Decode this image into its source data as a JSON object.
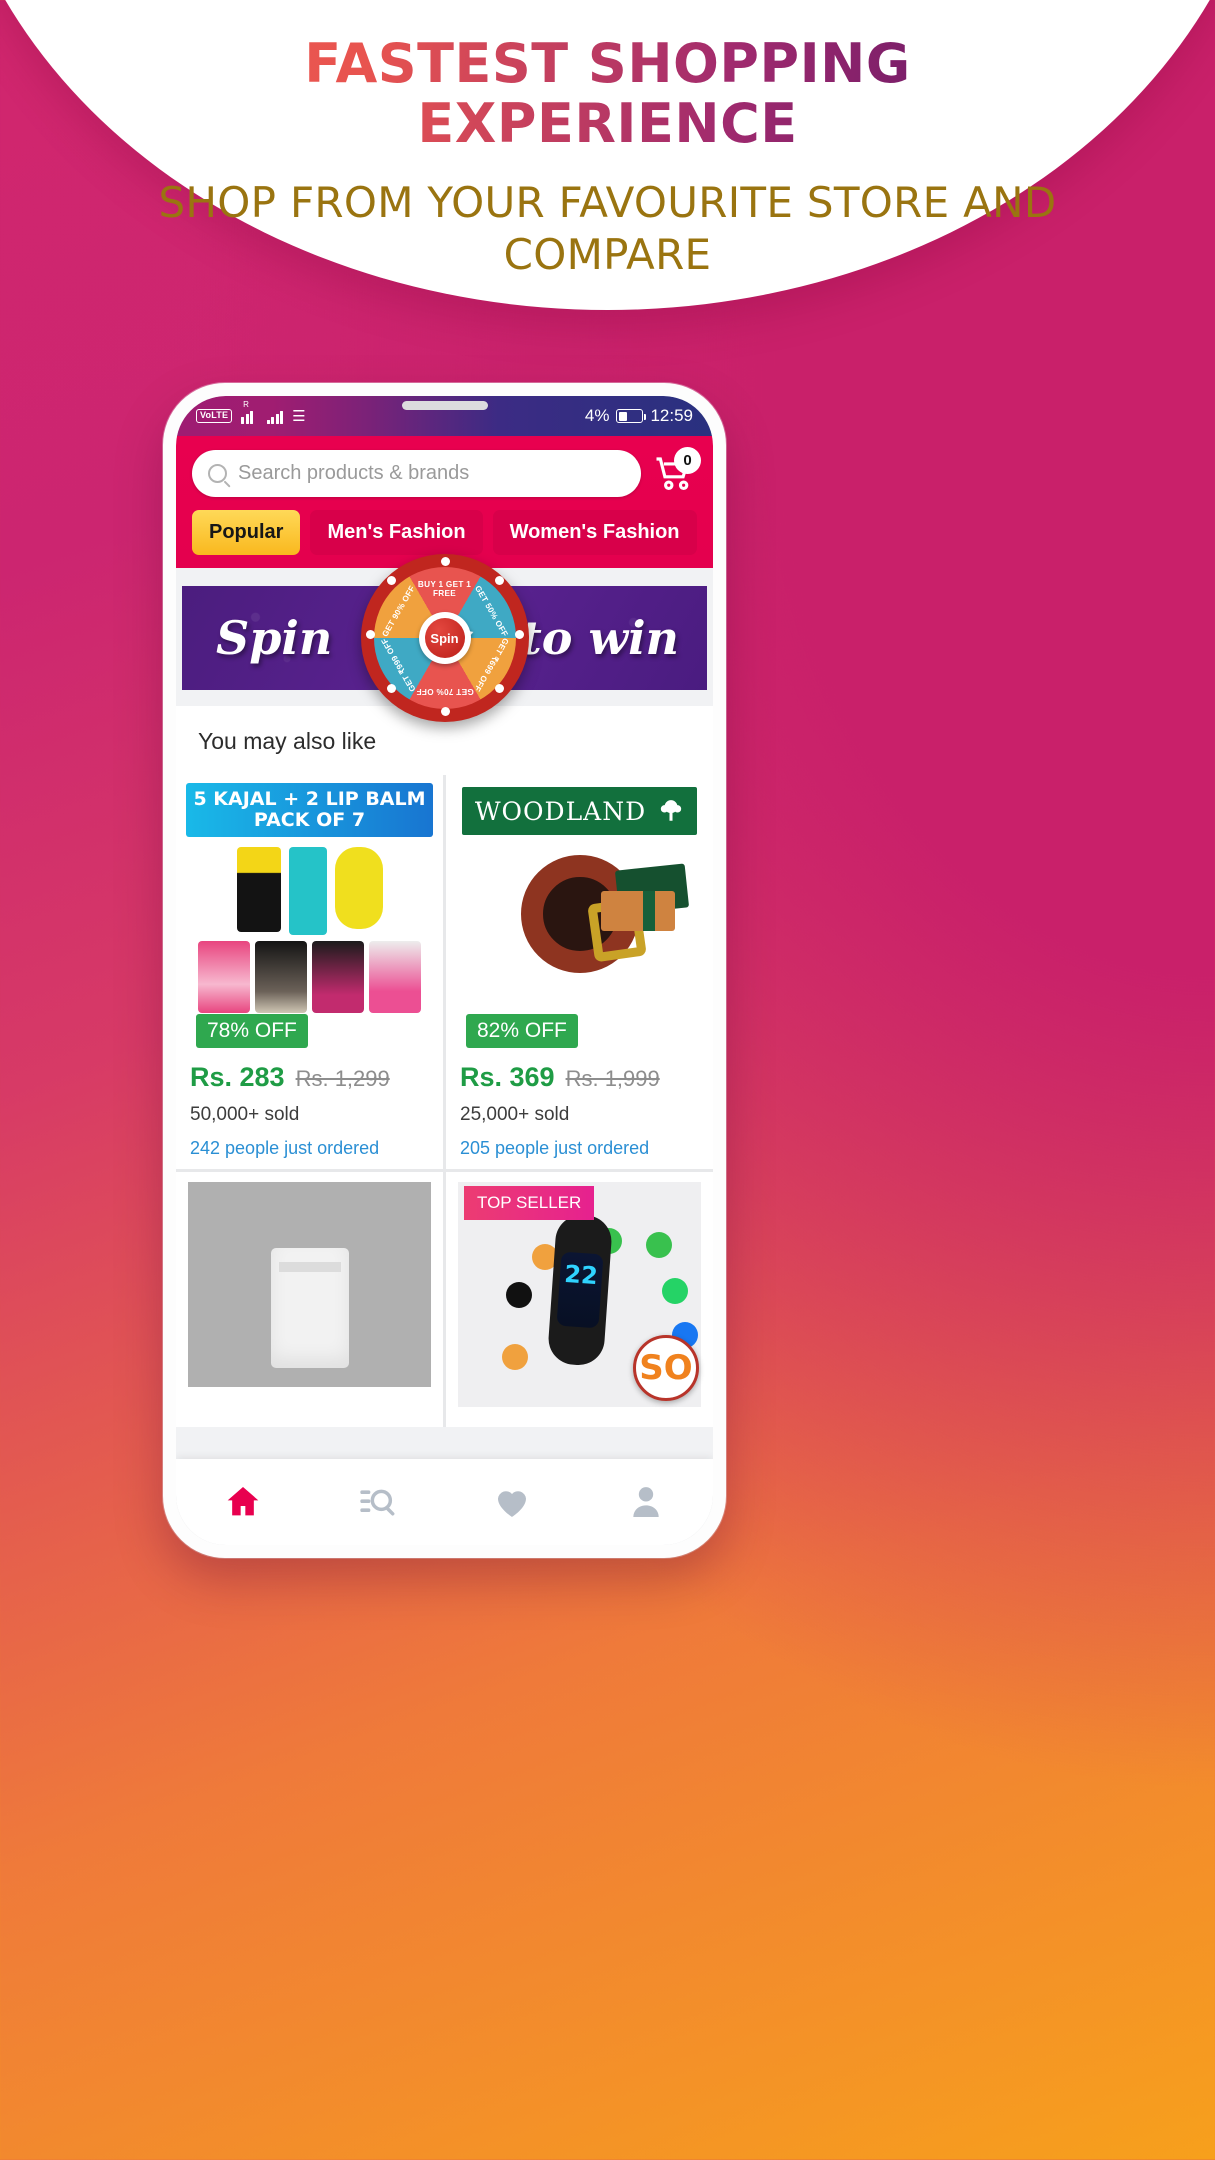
{
  "hero": {
    "title_line1": "FASTEST SHOPPING",
    "title_line2": "EXPERIENCE",
    "subtitle": "SHOP FROM YOUR FAVOURITE STORE AND COMPARE"
  },
  "colors": {
    "brand_red": "#e8004f",
    "accent_yellow": "#f9b81e",
    "banner_purple": "#4b1d7e",
    "discount_green": "#2fa84f",
    "price_green": "#1f9c45",
    "link_blue": "#2a8fd4",
    "bg_pink": "#d1266e",
    "bg_orange": "#f7a01c"
  },
  "statusbar": {
    "volte": "VoLTE",
    "roaming": "R",
    "signal_icon": "signal-bars-icon",
    "wifi_icon": "wifi-icon",
    "battery_percent": "4%",
    "battery_icon": "battery-icon",
    "time": "12:59"
  },
  "appbar": {
    "search": {
      "icon": "search-icon",
      "placeholder": "Search products & brands",
      "value": ""
    },
    "cart": {
      "icon": "cart-icon",
      "count": "0"
    },
    "tabs": [
      {
        "label": "Popular",
        "active": true
      },
      {
        "label": "Men's Fashion",
        "active": false
      },
      {
        "label": "Women's Fashion",
        "active": false
      }
    ]
  },
  "spin_banner": {
    "left_text": "Spin",
    "right_text": "to win",
    "hub_label": "Spin",
    "segments": [
      "BUY 1 GET 1 FREE",
      "GET 50% OFF",
      "GET ₹699 OFF",
      "GET 70% OFF",
      "GET ₹999 OFF",
      "GET 90% OFF"
    ]
  },
  "section": {
    "title": "You may also like"
  },
  "products": [
    {
      "image_title_line1": "5 KAJAL + 2 LIP BALM",
      "image_title_line2": "PACK OF 7",
      "discount": "78% OFF",
      "price": "Rs. 283",
      "mrp": "Rs. 1,299",
      "sold": "50,000+ sold",
      "ordered": "242 people just ordered"
    },
    {
      "brand": "WOODLAND",
      "discount": "82% OFF",
      "price": "Rs. 369",
      "mrp": "Rs. 1,999",
      "sold": "25,000+ sold",
      "ordered": "205 people just ordered"
    },
    {
      "badge": "",
      "discount": "",
      "price": "",
      "mrp": "",
      "sold": "",
      "ordered": ""
    },
    {
      "badge": "TOP SELLER",
      "watch_value": "22",
      "discount": "",
      "price": "",
      "mrp": "",
      "sold": "",
      "ordered": "",
      "so_badge": "SO"
    }
  ],
  "bottomnav": [
    {
      "icon": "home-icon",
      "active": true
    },
    {
      "icon": "search-list-icon",
      "active": false
    },
    {
      "icon": "heart-icon",
      "active": false
    },
    {
      "icon": "profile-icon",
      "active": false
    }
  ]
}
